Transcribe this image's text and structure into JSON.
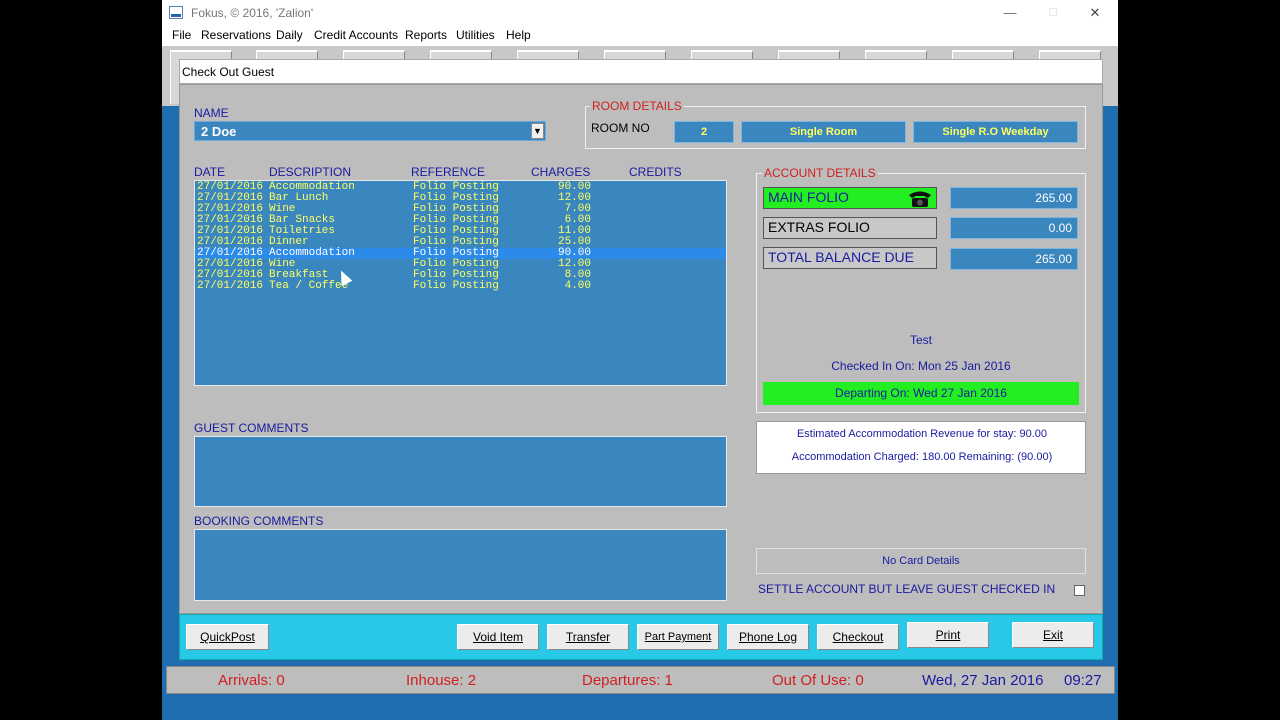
{
  "window": {
    "title": "Fokus, © 2016, 'Zalion'",
    "min_glyph": "—",
    "max_glyph": "☐",
    "close_glyph": "✕"
  },
  "menu": [
    "File",
    "Reservations",
    "Daily",
    "Credit Accounts",
    "Reports",
    "Utilities",
    "Help"
  ],
  "dialog": {
    "title": "Check Out Guest",
    "name_label": "NAME",
    "name_value": "2  Doe",
    "room_details": {
      "label": "ROOM DETAILS",
      "room_no_label": "ROOM NO",
      "room_no": "2",
      "room_type": "Single Room",
      "rate": "Single R.O Weekday"
    },
    "ledger": {
      "headers": {
        "date": "DATE",
        "description": "DESCRIPTION",
        "reference": "REFERENCE",
        "charges": "CHARGES",
        "credits": "CREDITS"
      },
      "rows": [
        {
          "date": "27/01/2016",
          "description": "Accommodation",
          "reference": "Folio Posting",
          "charges": "90.00",
          "selected": false
        },
        {
          "date": "27/01/2016",
          "description": "Bar Lunch",
          "reference": "Folio Posting",
          "charges": "12.00",
          "selected": false
        },
        {
          "date": "27/01/2016",
          "description": "Wine",
          "reference": "Folio Posting",
          "charges": "7.00",
          "selected": false
        },
        {
          "date": "27/01/2016",
          "description": "Bar Snacks",
          "reference": "Folio Posting",
          "charges": "6.00",
          "selected": false
        },
        {
          "date": "27/01/2016",
          "description": "Toiletries",
          "reference": "Folio Posting",
          "charges": "11.00",
          "selected": false
        },
        {
          "date": "27/01/2016",
          "description": "Dinner",
          "reference": "Folio Posting",
          "charges": "25.00",
          "selected": false
        },
        {
          "date": "27/01/2016",
          "description": "Accommodation",
          "reference": "Folio Posting",
          "charges": "90.00",
          "selected": true
        },
        {
          "date": "27/01/2016",
          "description": "Wine",
          "reference": "Folio Posting",
          "charges": "12.00",
          "selected": false
        },
        {
          "date": "27/01/2016",
          "description": "Breakfast",
          "reference": "Folio Posting",
          "charges": "8.00",
          "selected": false
        },
        {
          "date": "27/01/2016",
          "description": "Tea / Coffee",
          "reference": "Folio Posting",
          "charges": "4.00",
          "selected": false
        }
      ]
    },
    "guest_comments_label": "GUEST COMMENTS",
    "booking_comments_label": "BOOKING COMMENTS",
    "account_details": {
      "label": "ACCOUNT DETAILS",
      "main_folio_label": "MAIN FOLIO",
      "main_folio_value": "265.00",
      "extras_folio_label": "EXTRAS FOLIO",
      "extras_folio_value": "0.00",
      "total_label": "TOTAL BALANCE DUE",
      "total_value": "265.00"
    },
    "guest_info": {
      "name": "Test",
      "checked_in": "Checked In On: Mon 25 Jan 2016",
      "departing": "Departing On: Wed 27 Jan 2016"
    },
    "estimate": {
      "line1": "Estimated Accommodation Revenue for stay: 90.00",
      "line2": "Accommodation Charged: 180.00  Remaining: (90.00)"
    },
    "card_details": "No Card Details",
    "settle_label": "SETTLE ACCOUNT BUT LEAVE GUEST CHECKED IN",
    "colors": {
      "accent_blue": "#3a86bf",
      "green": "#22ee22",
      "label_red": "#d02020",
      "label_blue": "#1a1aa0",
      "text_yellow": "#ffff60"
    }
  },
  "buttons": {
    "quickpost": "QuickPost",
    "void_item": "Void Item",
    "transfer": "Transfer",
    "part_payment": "Part Payment",
    "phone_log": "Phone Log",
    "checkout": "Checkout",
    "print": "Print",
    "exit": "Exit"
  },
  "status": {
    "arrivals": "Arrivals:  0",
    "inhouse": "Inhouse:  2",
    "departures": "Departures:  1",
    "out_of_use": "Out Of Use:  0",
    "date": "Wed, 27 Jan 2016",
    "time": "09:27"
  }
}
